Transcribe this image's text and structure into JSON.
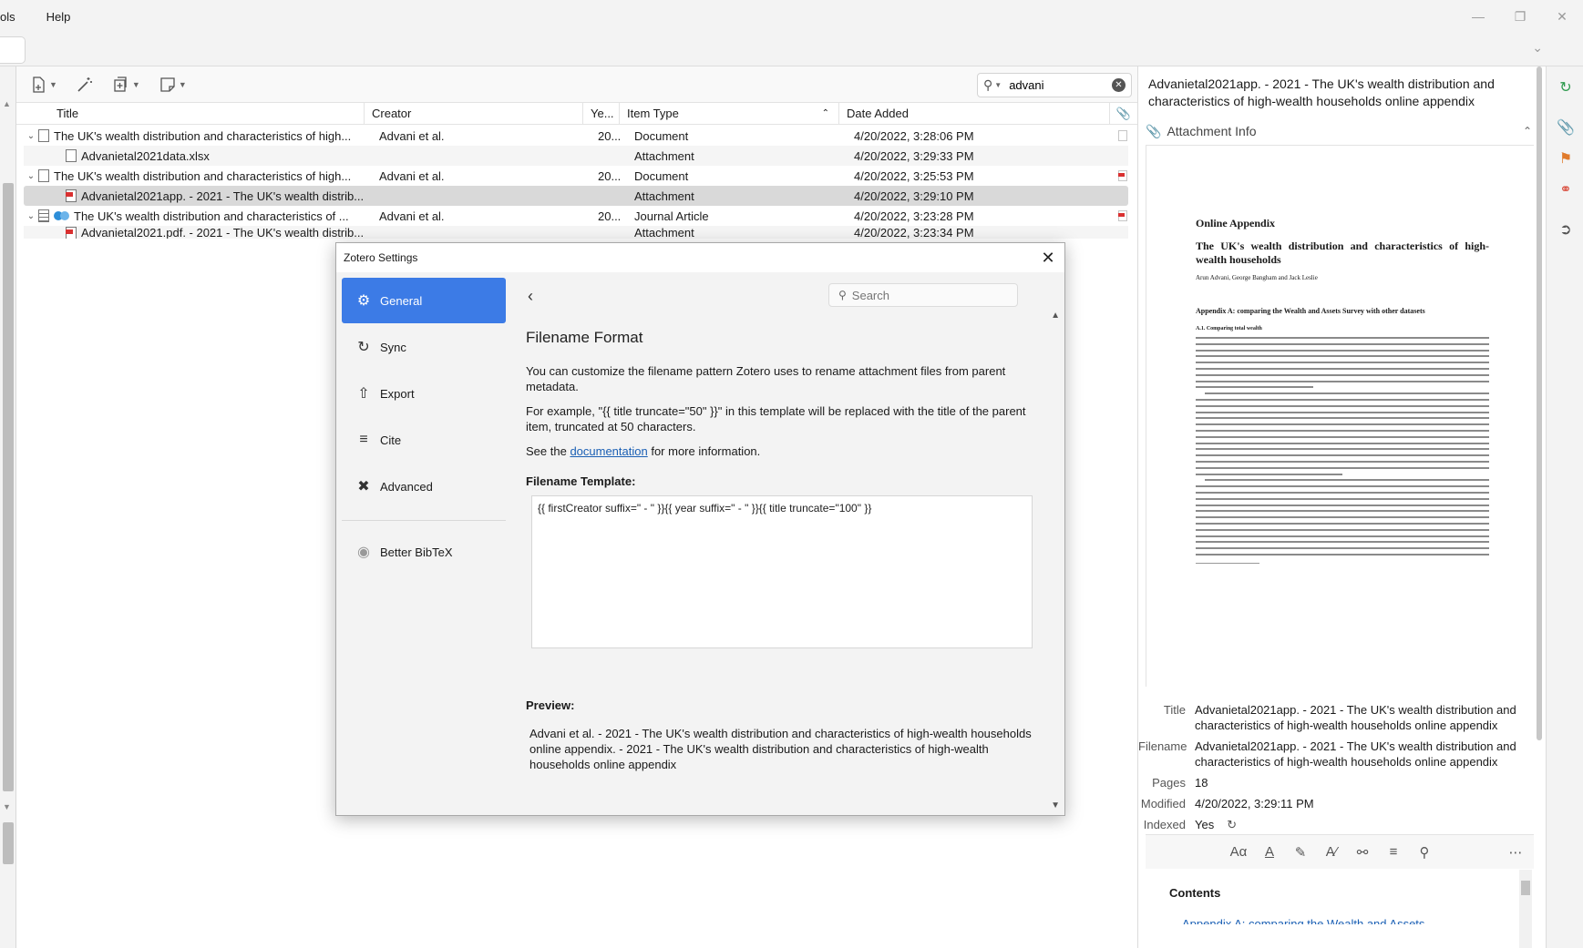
{
  "menu": [
    "ols",
    "Help"
  ],
  "search": {
    "value": "advani"
  },
  "columns": {
    "title": "Title",
    "creator": "Creator",
    "year": "Ye...",
    "item_type": "Item Type",
    "date_added": "Date Added"
  },
  "rows": [
    {
      "title": "The UK's wealth distribution and characteristics of high...",
      "creator": "Advani et al.",
      "year": "20...",
      "type": "Document",
      "date": "4/20/2022, 3:28:06 PM"
    },
    {
      "title": "Advanietal2021data.xlsx",
      "creator": "",
      "year": "",
      "type": "Attachment",
      "date": "4/20/2022, 3:29:33 PM"
    },
    {
      "title": "The UK's wealth distribution and characteristics of high...",
      "creator": "Advani et al.",
      "year": "20...",
      "type": "Document",
      "date": "4/20/2022, 3:25:53 PM"
    },
    {
      "title": "Advanietal2021app. - 2021 - The UK's wealth distrib...",
      "creator": "",
      "year": "",
      "type": "Attachment",
      "date": "4/20/2022, 3:29:10 PM"
    },
    {
      "title": "The UK's wealth distribution and characteristics of ...",
      "creator": "Advani et al.",
      "year": "20...",
      "type": "Journal Article",
      "date": "4/20/2022, 3:23:28 PM"
    },
    {
      "title": "Advanietal2021.pdf. - 2021 - The UK's wealth distrib...",
      "creator": "",
      "year": "",
      "type": "Attachment",
      "date": "4/20/2022, 3:23:34 PM"
    }
  ],
  "item_pane": {
    "header": "Advanietal2021app. - 2021 - The UK's wealth distribution and characteristics of high-wealth households online appendix",
    "section_title": "Attachment Info",
    "preview": {
      "heading": "Online Appendix",
      "title": "The UK's wealth distribution and characteristics of high-wealth households",
      "authors": "Arun Advani, George Bangham and Jack Leslie",
      "section": "Appendix A: comparing the Wealth and Assets Survey with other datasets",
      "subsection": "A.1. Comparing total wealth"
    },
    "info": {
      "title_label": "Title",
      "title_value": "Advanietal2021app. - 2021 - The UK's wealth distribution and characteristics of high-wealth households online appendix",
      "filename_label": "Filename",
      "filename_value": "Advanietal2021app. - 2021 - The UK's wealth distribution and characteristics of high-wealth households online appendix",
      "pages_label": "Pages",
      "pages_value": "18",
      "modified_label": "Modified",
      "modified_value": "4/20/2022, 3:29:11 PM",
      "indexed_label": "Indexed",
      "indexed_value": "Yes"
    },
    "contents_heading": "Contents",
    "contents_link": "Appendix A: comparing the Wealth and Assets"
  },
  "dialog": {
    "title": "Zotero Settings",
    "nav": [
      "General",
      "Sync",
      "Export",
      "Cite",
      "Advanced"
    ],
    "plugin_nav": "Better BibTeX",
    "search_placeholder": "Search",
    "heading": "Filename Format",
    "para1": "You can customize the filename pattern Zotero uses to rename attachment files from parent metadata.",
    "para2": "For example, \"{{ title truncate=\"50\" }}\" in this template will be replaced with the title of the parent item, truncated at 50 characters.",
    "para3_before": "See the ",
    "para3_link": "documentation",
    "para3_after": " for more information.",
    "template_label": "Filename Template:",
    "template_value": "{{ firstCreator suffix=\" - \" }}{{ year suffix=\" - \" }}{{ title truncate=\"100\" }}",
    "preview_label": "Preview:",
    "preview_value": "Advani et al. - 2021 - The UK's wealth distribution and characteristics of high-wealth households online appendix. - 2021 - The UK's wealth distribution and characteristics of high-wealth households online appendix"
  }
}
